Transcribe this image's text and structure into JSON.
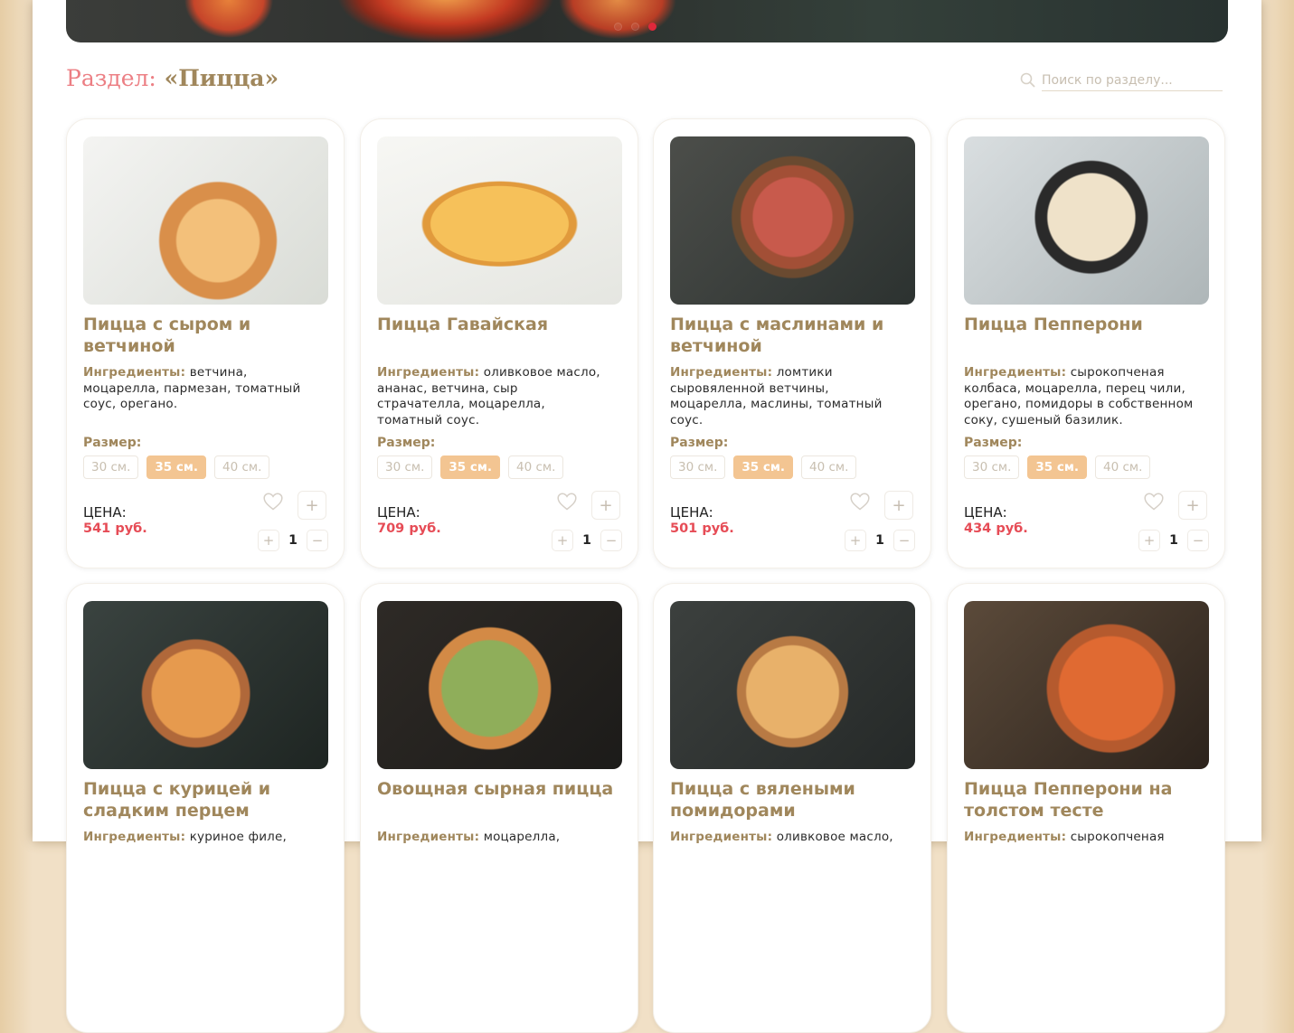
{
  "section": {
    "prefix": "Раздел:",
    "name": "«Пицца»"
  },
  "search": {
    "placeholder": "Поиск по разделу..."
  },
  "slider": {
    "dots": 3,
    "active": 2
  },
  "labels": {
    "ingredients": "Ингредиенты:",
    "size": "Размер:",
    "price": "ЦЕНА:"
  },
  "size_options": [
    "30 см.",
    "35 см.",
    "40 см."
  ],
  "icons": {
    "search": "search-icon",
    "favorite": "heart-icon",
    "add": "plus-icon",
    "increase": "plus-icon",
    "decrease": "minus-icon"
  },
  "colors": {
    "accent": "#a0875c",
    "price": "#e64c56",
    "active_size": "#f3c592",
    "section_prefix": "#ec7f84"
  },
  "products": [
    {
      "name": "Пицца с сыром и ветчиной",
      "ingredients": "ветчина, моцарелла, пармезан, томатный соус, орегано.",
      "selected_size": "35 см.",
      "price": "541 руб.",
      "quantity": "1"
    },
    {
      "name": "Пицца Гавайская",
      "ingredients": "оливковое масло, ананас, ветчина, сыр страчателла, моцарелла, томатный соус.",
      "selected_size": "35 см.",
      "price": "709 руб.",
      "quantity": "1"
    },
    {
      "name": "Пицца с маслинами и ветчиной",
      "ingredients": "ломтики сыровяленной ветчины, моцарелла, маслины, томатный соус.",
      "selected_size": "35 см.",
      "price": "501 руб.",
      "quantity": "1"
    },
    {
      "name": "Пицца Пепперони",
      "ingredients": "сырокопченая колбаса, моцарелла, перец чили, орегано, помидоры в собственном соку, сушеный базилик.",
      "selected_size": "35 см.",
      "price": "434 руб.",
      "quantity": "1"
    },
    {
      "name": "Пицца с курицей и сладким перцем",
      "ingredients": "куриное филе,"
    },
    {
      "name": "Овощная сырная пицца",
      "ingredients": "моцарелла,"
    },
    {
      "name": "Пицца с вялеными помидорами",
      "ingredients": "оливковое масло,"
    },
    {
      "name": "Пицца Пепперони на толстом тесте",
      "ingredients": "сырокопченая"
    }
  ]
}
